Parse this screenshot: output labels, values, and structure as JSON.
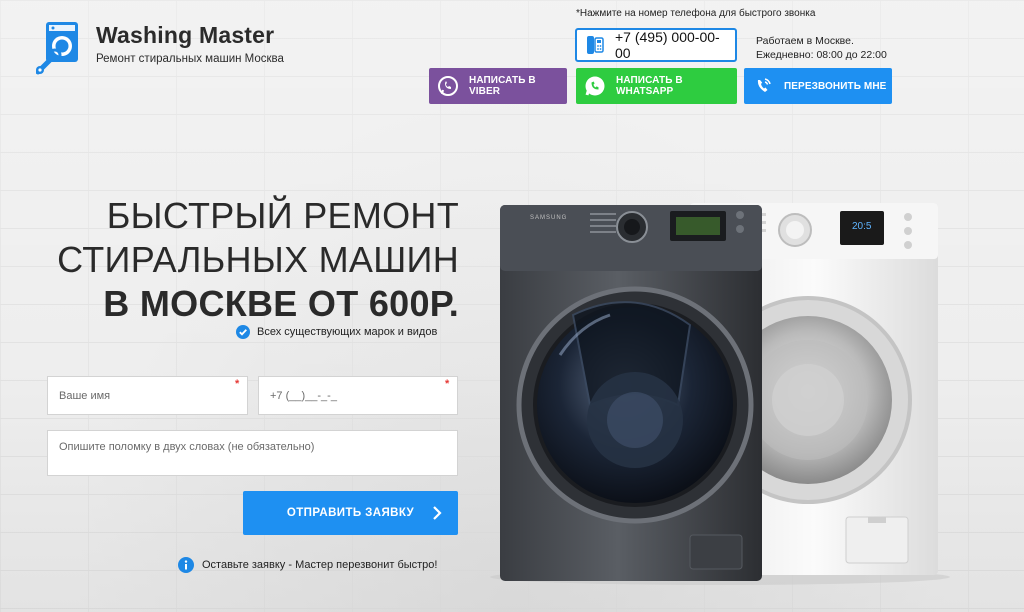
{
  "logo": {
    "title": "Washing Master",
    "subtitle": "Ремонт стиральных машин Москва"
  },
  "header": {
    "call_note": "*Нажмите на номер телефона для быстрого звонка",
    "phone": "+7 (495) 000-00-00",
    "hours_line1": "Работаем в Москве.",
    "hours_line2": "Ежедневно: 08:00 до 22:00",
    "buttons": {
      "viber": "НАПИСАТЬ В VIBER",
      "whatsapp": "НАПИСАТЬ В WHATSAPP",
      "callback": "ПЕРЕЗВОНИТЬ МНЕ"
    }
  },
  "hero": {
    "line1": "БЫСТРЫЙ РЕМОНТ",
    "line2": "СТИРАЛЬНЫХ МАШИН",
    "line3": "В МОСКВЕ ОТ 600Р.",
    "brands_note": "Всех существующих марок и видов"
  },
  "form": {
    "name_placeholder": "Ваше имя",
    "phone_placeholder": "+7 (__)__-_-_",
    "issue_placeholder": "Опишите поломку в двух словах (не обязательно)",
    "required_mark": "*",
    "submit_label": "ОТПРАВИТЬ ЗАЯВКУ",
    "footnote": "Оставьте заявку - Мастер перезвонит быстро!"
  },
  "machine": {
    "brand_text": "SAMSUNG",
    "display_text": "20:5"
  },
  "colors": {
    "accent": "#1e90f2",
    "viber": "#7b519d",
    "whatsapp": "#2ecc40",
    "required": "#e53935"
  },
  "icons": {
    "logo": "washing-machine-wrench-icon",
    "phone": "phone-icon",
    "viber": "viber-icon",
    "whatsapp": "whatsapp-icon",
    "callback": "phone-callback-icon",
    "check": "check-circle-icon",
    "chevron": "chevron-right-icon",
    "info": "info-icon"
  }
}
